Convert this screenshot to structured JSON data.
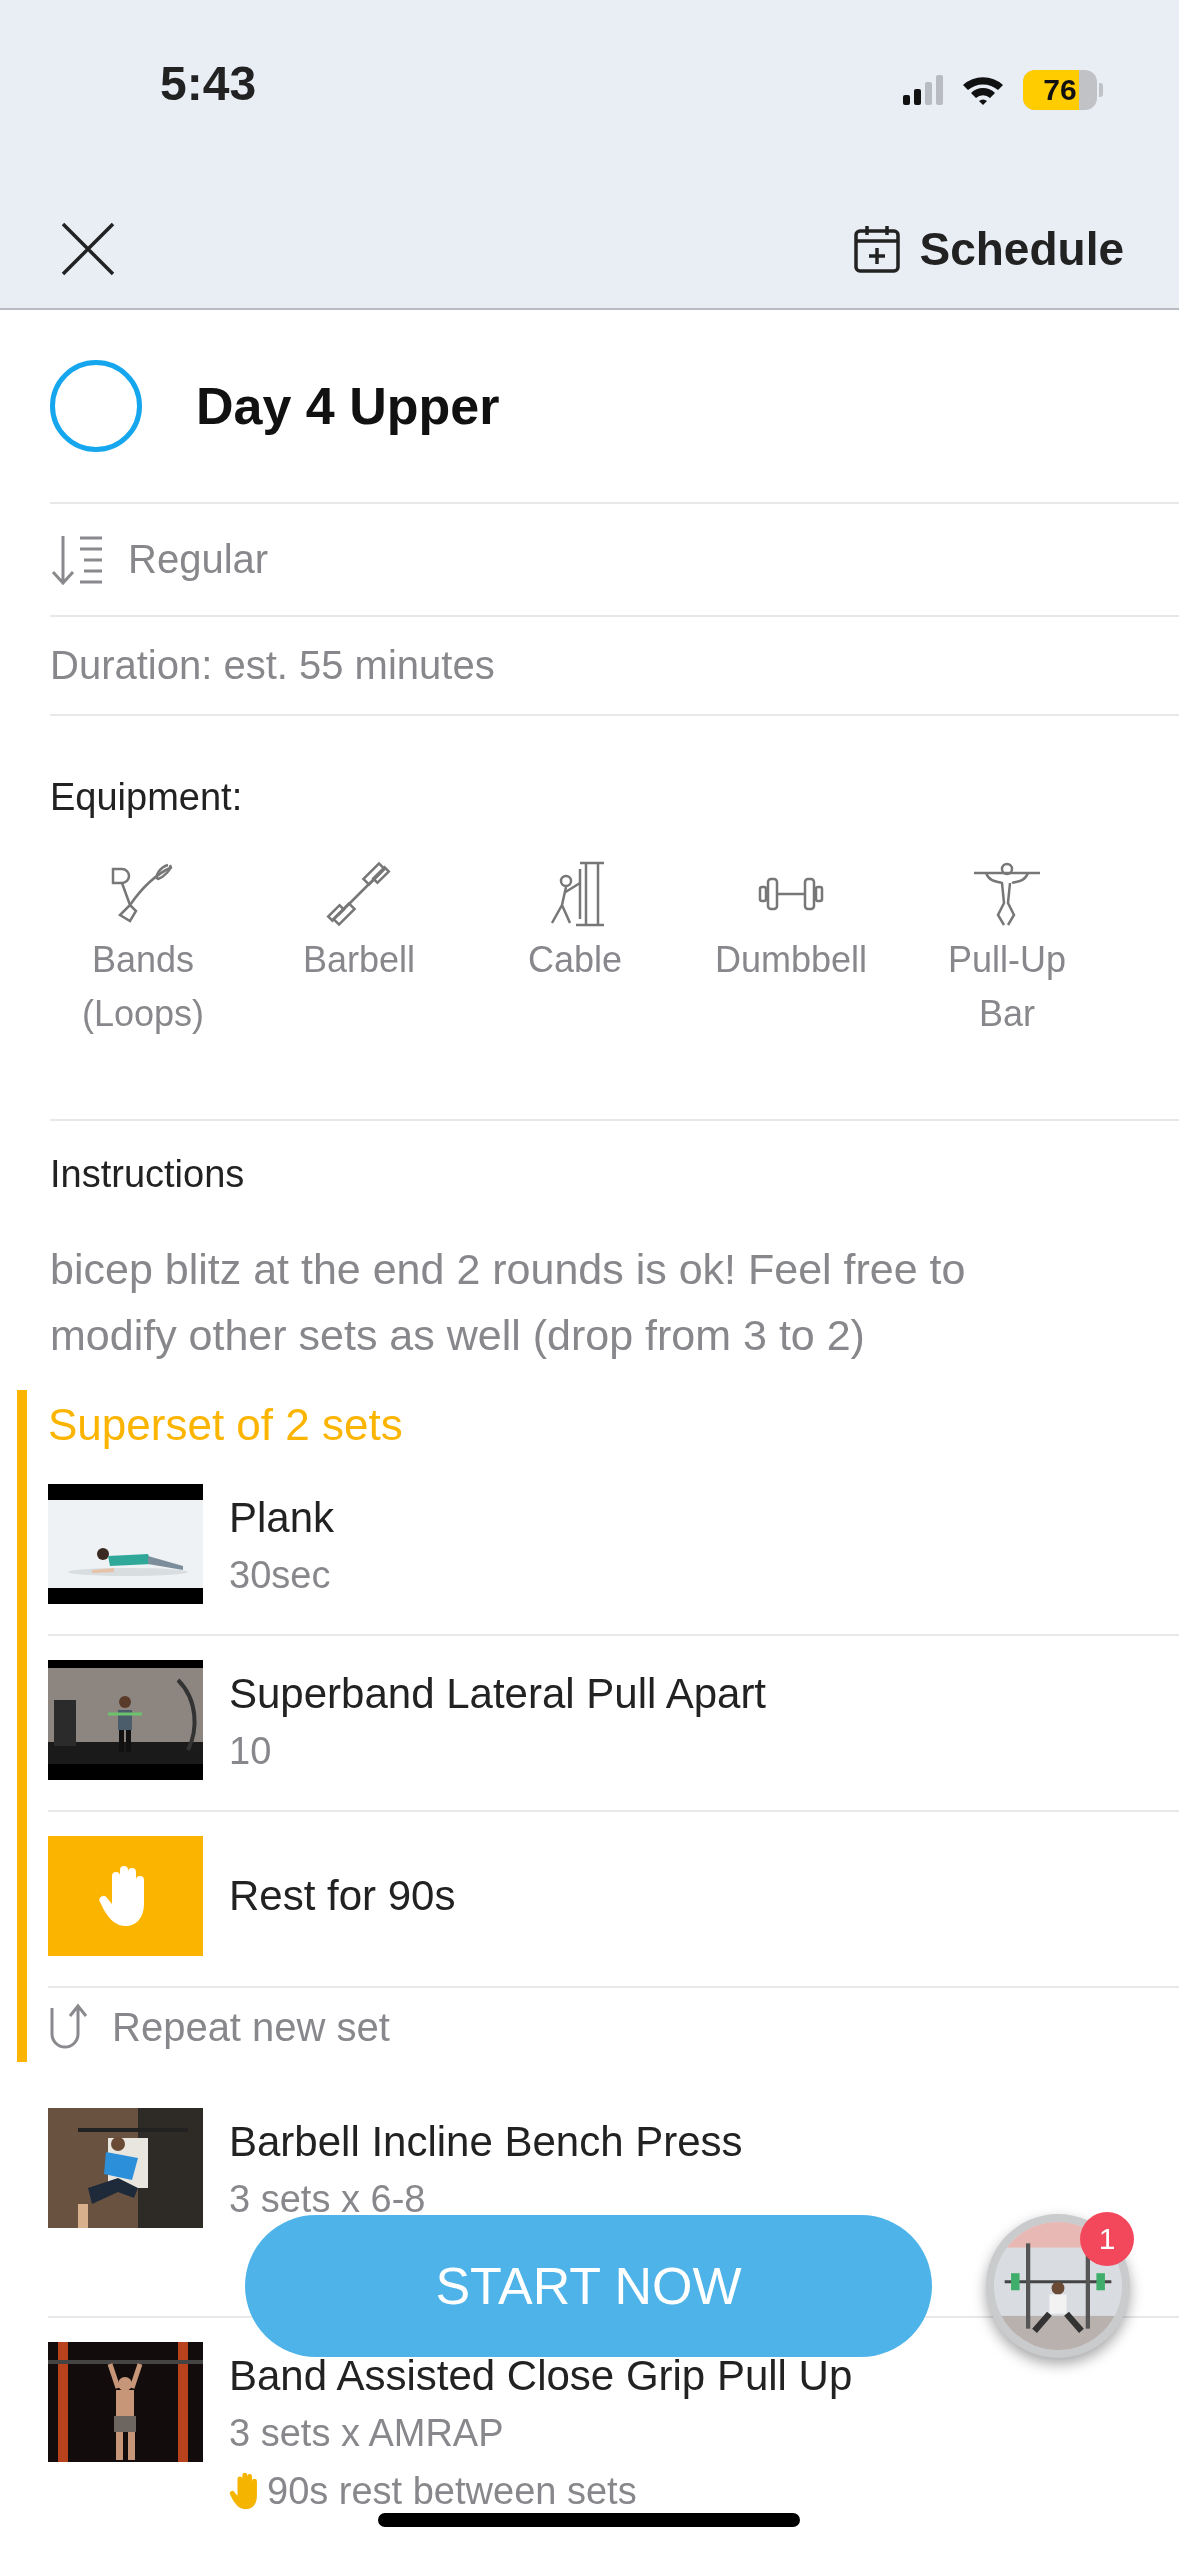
{
  "status_bar": {
    "time": "5:43",
    "battery": "76"
  },
  "header": {
    "schedule_label": "Schedule"
  },
  "workout": {
    "title": "Day 4 Upper",
    "completed": false,
    "order": "Regular",
    "duration": "Duration: est. 55 minutes"
  },
  "equipment": {
    "heading": "Equipment:",
    "items": [
      {
        "kind": "bands",
        "label": "Bands (Loops)"
      },
      {
        "kind": "barbell",
        "label": "Barbell"
      },
      {
        "kind": "cable",
        "label": "Cable"
      },
      {
        "kind": "dumbbell",
        "label": "Dumbbell"
      },
      {
        "kind": "pullup",
        "label": "Pull-Up Bar"
      }
    ]
  },
  "instructions": {
    "heading": "Instructions",
    "text": "bicep blitz at the end 2 rounds is ok! Feel free to modify other sets as well (drop from 3 to 2)"
  },
  "superset": {
    "title": "Superset of 2 sets",
    "items": [
      {
        "kind": "exercise",
        "name": "Plank",
        "detail": "30sec"
      },
      {
        "kind": "exercise",
        "name": "Superband Lateral Pull Apart",
        "detail": "10"
      },
      {
        "kind": "rest",
        "name": "Rest for 90s"
      }
    ],
    "repeat": "Repeat new set"
  },
  "exercises": [
    {
      "name": "Barbell Incline Bench Press",
      "detail": "3 sets x 6-8"
    },
    {
      "name": "Band Assisted Close Grip Pull Up",
      "detail": "3 sets x AMRAP",
      "rest": "90s rest between sets"
    }
  ],
  "start_button": "START NOW",
  "floating_badge": "1"
}
